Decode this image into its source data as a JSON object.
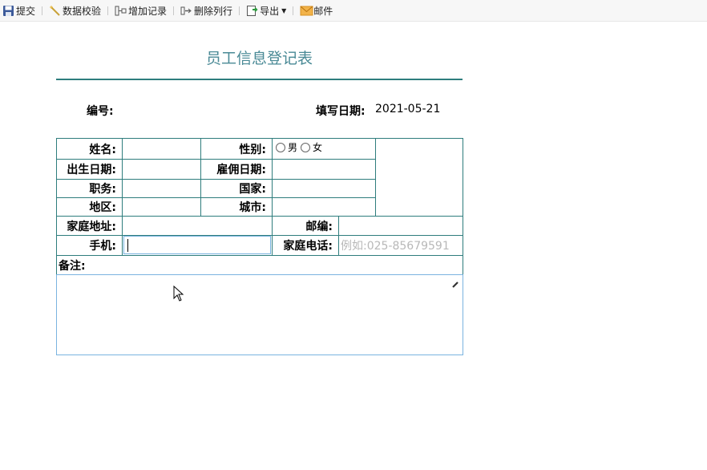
{
  "toolbar": {
    "items": [
      {
        "label": "提交",
        "icon": "save-icon"
      },
      {
        "label": "数据校验",
        "icon": "wand-icon"
      },
      {
        "label": "增加记录",
        "icon": "add-record-icon"
      },
      {
        "label": "删除列行",
        "icon": "delete-row-icon"
      },
      {
        "label": "导出",
        "icon": "export-icon"
      },
      {
        "label": "邮件",
        "icon": "mail-icon"
      }
    ]
  },
  "form": {
    "title": "员工信息登记表",
    "number_label": "编号:",
    "date_label": "填写日期:",
    "date_value": "2021-05-21",
    "labels": {
      "name": "姓名:",
      "gender": "性别:",
      "birth": "出生日期:",
      "hire": "雇佣日期:",
      "position": "职务:",
      "country": "国家:",
      "region": "地区:",
      "city": "城市:",
      "address": "家庭地址:",
      "zip": "邮编:",
      "mobile": "手机:",
      "phone": "家庭电话:",
      "remark": "备注:"
    },
    "gender_options": [
      "男",
      "女"
    ],
    "phone_placeholder": "例如:025-85679591"
  },
  "colors": {
    "border": "#2e7d7d",
    "title": "#4a8a96",
    "focus": "#7ab3e0"
  }
}
